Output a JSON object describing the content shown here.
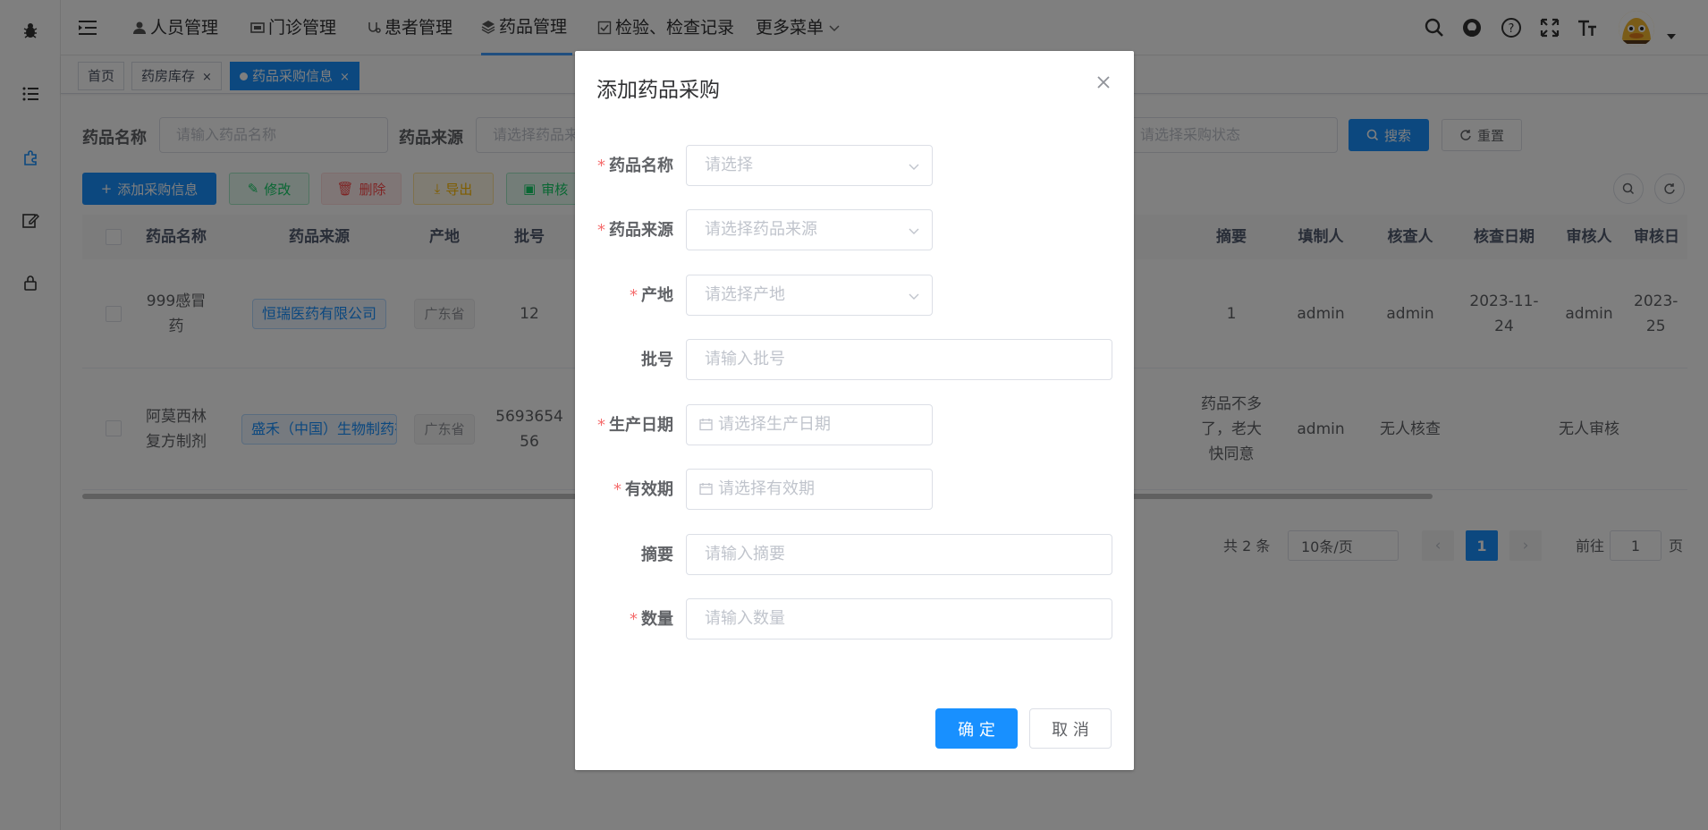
{
  "nav": {
    "menu": [
      {
        "label": "人员管理",
        "icon": "user-icon"
      },
      {
        "label": "门诊管理",
        "icon": "clinic-icon"
      },
      {
        "label": "患者管理",
        "icon": "patient-icon"
      },
      {
        "label": "药品管理",
        "icon": "layers-icon",
        "active": true
      },
      {
        "label": "检验、检查记录",
        "icon": "checkbox-icon"
      },
      {
        "label": "更多菜单",
        "icon": "chevron-down-icon"
      }
    ],
    "right_icons": [
      "search-icon",
      "github-icon",
      "help-icon",
      "fullscreen-icon",
      "font-size-icon"
    ]
  },
  "tags": [
    {
      "label": "首页"
    },
    {
      "label": "药房库存"
    },
    {
      "label": "药品采购信息",
      "active": true
    }
  ],
  "search": {
    "drug_name_label": "药品名称",
    "drug_name_placeholder": "请输入药品名称",
    "source_label": "药品来源",
    "source_placeholder": "请选择药品来",
    "status_placeholder": "请选择采购状态",
    "search_btn": "搜索",
    "reset_btn": "重置"
  },
  "toolbar": {
    "add": "添加采购信息",
    "edit": "修改",
    "delete": "删除",
    "export": "导出",
    "audit": "审核"
  },
  "table": {
    "headers": [
      "药品名称",
      "药品来源",
      "产地",
      "批号",
      "摘要",
      "填制人",
      "核查人",
      "核查日期",
      "审核人",
      "审核日"
    ],
    "rows": [
      {
        "name": "999感冒\n药",
        "source": "恒瑞医药有限公司",
        "origin": "广东省",
        "batch": "12",
        "summary": "1",
        "filler": "admin",
        "checker": "admin",
        "check_date": "2023-11-\n24",
        "auditor": "admin",
        "audit_date": "2023-\n25"
      },
      {
        "name": "阿莫西林\n复方制剂",
        "source": "盛禾（中国）生物制药有",
        "origin": "广东省",
        "batch": "5693654\n56",
        "summary": "药品不多\n了，老大\n快同意",
        "filler": "admin",
        "checker": "无人核查",
        "check_date": "",
        "auditor": "无人审核",
        "audit_date": ""
      }
    ]
  },
  "pagination": {
    "total": "共 2 条",
    "page_size": "10条/页",
    "current": "1",
    "goto_label": "前往",
    "goto_value": "1",
    "page_suffix": "页"
  },
  "dialog": {
    "title": "添加药品采购",
    "fields": [
      {
        "label": "药品名称",
        "required": true,
        "placeholder": "请选择",
        "type": "select"
      },
      {
        "label": "药品来源",
        "required": true,
        "placeholder": "请选择药品来源",
        "type": "select"
      },
      {
        "label": "产地",
        "required": true,
        "placeholder": "请选择产地",
        "type": "select"
      },
      {
        "label": "批号",
        "required": false,
        "placeholder": "请输入批号",
        "type": "text"
      },
      {
        "label": "生产日期",
        "required": true,
        "placeholder": "请选择生产日期",
        "type": "date"
      },
      {
        "label": "有效期",
        "required": true,
        "placeholder": "请选择有效期",
        "type": "date"
      },
      {
        "label": "摘要",
        "required": false,
        "placeholder": "请输入摘要",
        "type": "text"
      },
      {
        "label": "数量",
        "required": true,
        "placeholder": "请输入数量",
        "type": "text"
      }
    ],
    "confirm": "确 定",
    "cancel": "取 消"
  },
  "colors": {
    "primary": "#1890ff",
    "required": "#f56c6c",
    "overlay": "rgba(0,0,0,0.5)"
  }
}
